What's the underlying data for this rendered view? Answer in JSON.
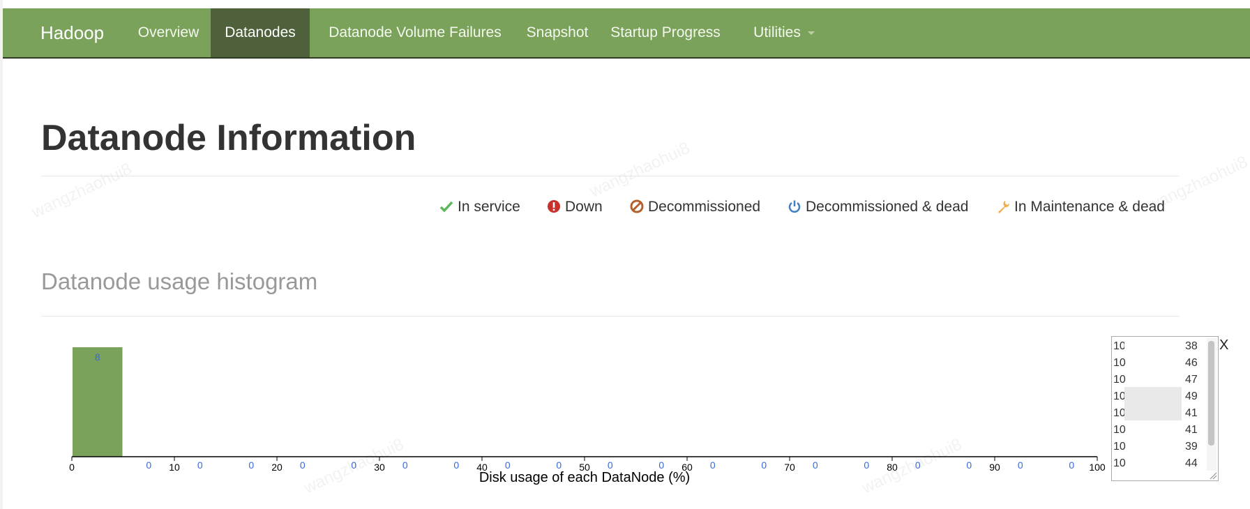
{
  "navbar": {
    "brand": "Hadoop",
    "items": [
      {
        "label": "Overview",
        "active": false
      },
      {
        "label": "Datanodes",
        "active": true
      },
      {
        "label": "Datanode Volume Failures",
        "active": false
      },
      {
        "label": "Snapshot",
        "active": false
      },
      {
        "label": "Startup Progress",
        "active": false
      },
      {
        "label": "Utilities",
        "active": false,
        "dropdown": true
      }
    ]
  },
  "page": {
    "title": "Datanode Information",
    "histogram_title": "Datanode usage histogram"
  },
  "legend": [
    {
      "label": "In service",
      "icon": "checkmark-icon",
      "color": "#5cb85c"
    },
    {
      "label": "Down",
      "icon": "exclamation-circle-icon",
      "color": "#c9302c"
    },
    {
      "label": "Decommissioned",
      "icon": "ban-icon",
      "color": "#b3602b"
    },
    {
      "label": "Decommissioned & dead",
      "icon": "power-icon",
      "color": "#3f7fc2"
    },
    {
      "label": "In Maintenance & dead",
      "icon": "wrench-icon",
      "color": "#f0ad4e"
    }
  ],
  "chart_data": {
    "type": "bar",
    "xlabel": "Disk usage of each DataNode (%)",
    "xlim": [
      0,
      100
    ],
    "x_ticks": [
      0,
      10,
      20,
      30,
      40,
      50,
      60,
      70,
      80,
      90,
      100
    ],
    "bins": [
      0,
      5,
      10,
      15,
      20,
      25,
      30,
      35,
      40,
      45,
      50,
      55,
      60,
      65,
      70,
      75,
      80,
      85,
      90,
      95,
      100
    ],
    "values": [
      8,
      0,
      0,
      0,
      0,
      0,
      0,
      0,
      0,
      0,
      0,
      0,
      0,
      0,
      0,
      0,
      0,
      0,
      0,
      0
    ],
    "bar_color": "#7aa25a",
    "label_color": "#3a67d8"
  },
  "node_list": {
    "rows": [
      {
        "prefix": "10",
        "suffix": "38"
      },
      {
        "prefix": "10",
        "suffix": "46"
      },
      {
        "prefix": "10",
        "suffix": "47"
      },
      {
        "prefix": "10",
        "suffix": "49"
      },
      {
        "prefix": "10",
        "suffix": "41"
      },
      {
        "prefix": "10",
        "suffix": "41"
      },
      {
        "prefix": "10",
        "suffix": "39"
      },
      {
        "prefix": "10",
        "suffix": "44"
      }
    ],
    "close_label": "X"
  },
  "watermark": "wangzhaohui8"
}
